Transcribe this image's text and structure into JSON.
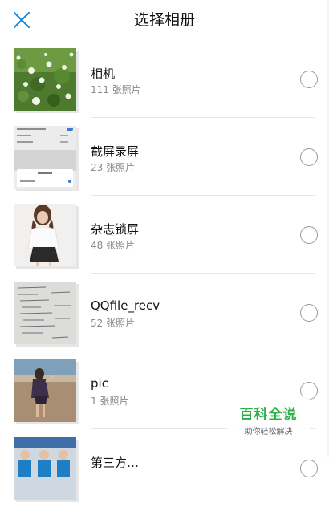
{
  "header": {
    "title": "选择相册"
  },
  "albums": [
    {
      "name": "相机",
      "count": "111 张照片",
      "thumb": "clover-flowers"
    },
    {
      "name": "截屏录屏",
      "count": "23 张照片",
      "thumb": "settings-screenshot"
    },
    {
      "name": "杂志锁屏",
      "count": "48 张照片",
      "thumb": "woman-portrait"
    },
    {
      "name": "QQfile_recv",
      "count": "52 张照片",
      "thumb": "handwritten-notes"
    },
    {
      "name": "pic",
      "count": "1 张照片",
      "thumb": "beach-figure"
    },
    {
      "name": "第三方…",
      "count": "",
      "thumb": "group-photo"
    }
  ],
  "watermark": {
    "title": "百科全说",
    "subtitle": "助你轻松解决"
  },
  "colors": {
    "accent": "#1f8ad6",
    "brand_green": "#27b346"
  }
}
